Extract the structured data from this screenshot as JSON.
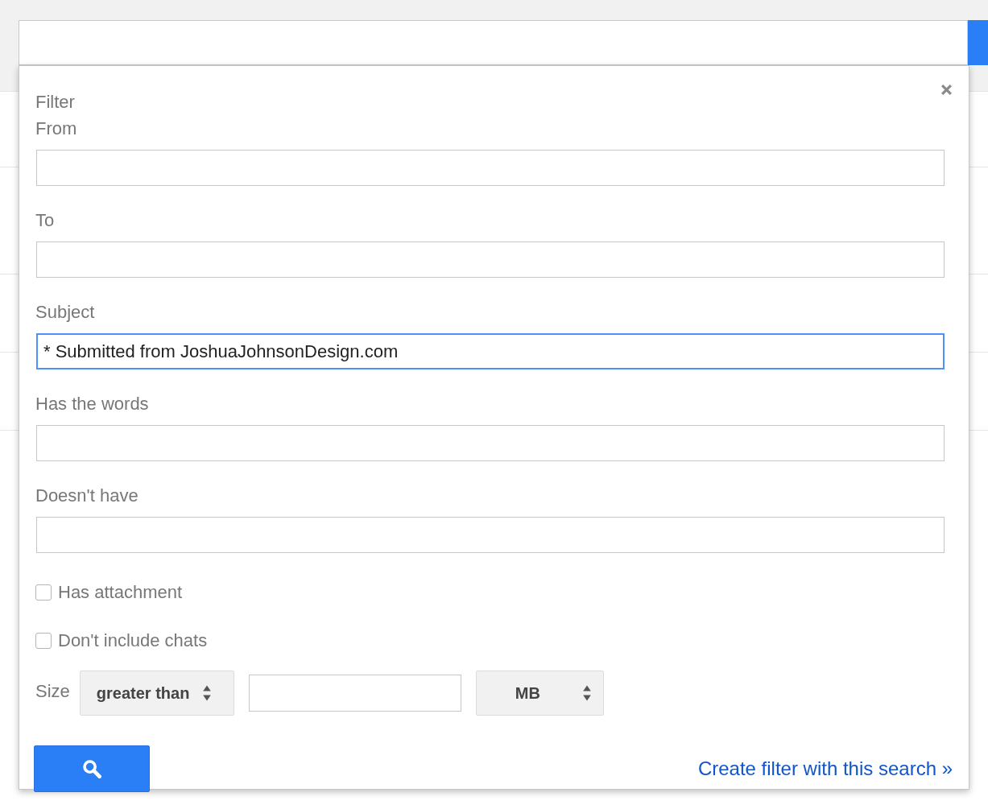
{
  "dialog": {
    "title": "Filter",
    "fields": [
      {
        "label": "From",
        "focused": false
      },
      {
        "label": "To",
        "focused": false
      },
      {
        "label": "Subject",
        "value": "* Submitted from JoshuaJohnsonDesign.com",
        "focused": true
      },
      {
        "label": "Has the words",
        "focused": false
      },
      {
        "label": "Doesn't have",
        "focused": false
      }
    ],
    "checkboxes": [
      {
        "label": "Has attachment",
        "checked": false
      },
      {
        "label": "Don't include chats",
        "checked": false
      }
    ],
    "size": {
      "label": "Size",
      "operator": "greater than",
      "unit": "MB"
    },
    "create_filter_link": "Create filter with this search »"
  }
}
